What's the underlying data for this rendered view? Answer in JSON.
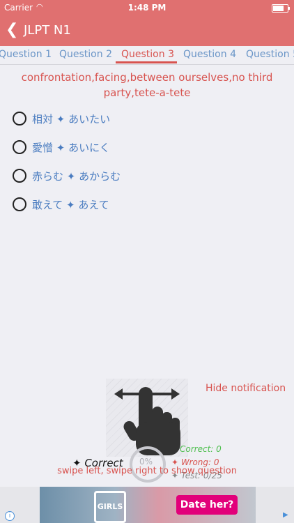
{
  "status_bar": {
    "carrier": "Carrier",
    "time": "1:48 PM"
  },
  "nav": {
    "title": "JLPT N1"
  },
  "tabs": [
    "Question 1",
    "Question 2",
    "Question 3",
    "Question 4",
    "Question 5"
  ],
  "question": {
    "text": "confrontation,facing,between ourselves,no third party,tete-a-tete"
  },
  "options": [
    {
      "label": "相対 ✦ あいたい"
    },
    {
      "label": "愛憎 ✦ あいにく"
    },
    {
      "label": "赤らむ ✦ あからむ"
    },
    {
      "label": "敢えて ✦ あえて"
    }
  ],
  "notification": {
    "hide_label": "Hide notification",
    "swipe_message": "swipe left, swipe right to show question"
  },
  "stats": {
    "big_label": "✦ Correct",
    "percent": "0%",
    "correct": "Correct: 0",
    "wrong": "✦ Wrong:  0",
    "test": "✦ Test:    0/25"
  },
  "ad": {
    "logo_text": "GIRLS",
    "cta": "Date her?"
  },
  "colors": {
    "accent": "#e07070",
    "tab_active": "#d8534f",
    "tab": "#6a95c7",
    "option_text": "#4a7cc0"
  }
}
